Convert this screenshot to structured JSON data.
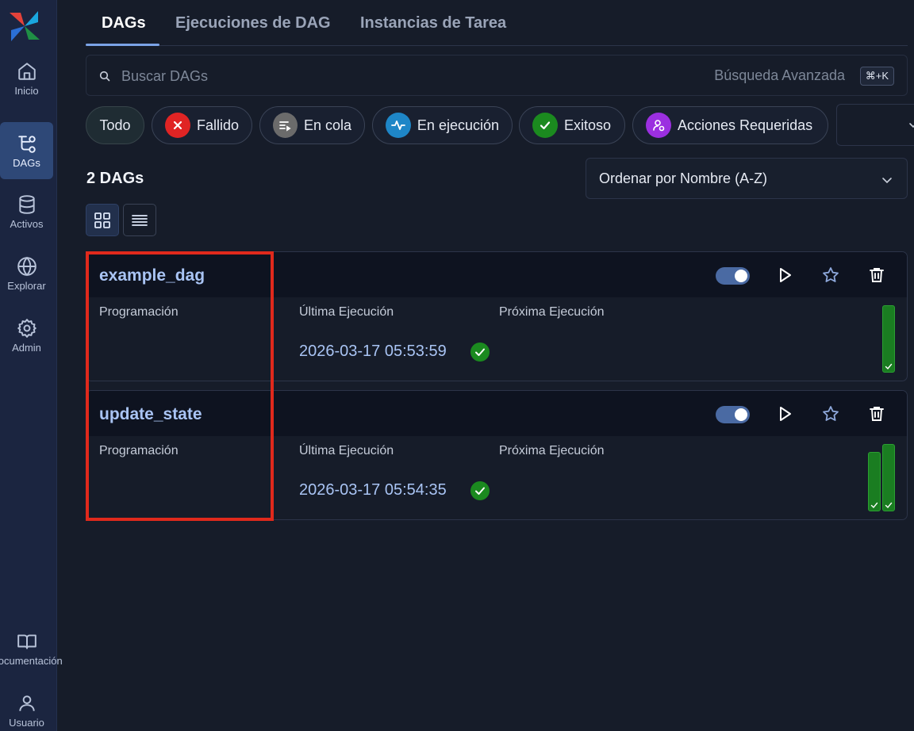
{
  "sidebar": {
    "items": [
      {
        "label": "Inicio",
        "icon": "home-icon"
      },
      {
        "label": "DAGs",
        "icon": "dags-icon",
        "active": true
      },
      {
        "label": "Activos",
        "icon": "database-icon"
      },
      {
        "label": "Explorar",
        "icon": "globe-icon"
      },
      {
        "label": "Admin",
        "icon": "gear-icon"
      }
    ],
    "bottom": [
      {
        "label": "Documentación",
        "icon": "book-icon"
      },
      {
        "label": "Usuario",
        "icon": "user-icon"
      }
    ]
  },
  "tabs": [
    {
      "label": "DAGs",
      "active": true
    },
    {
      "label": "Ejecuciones de DAG"
    },
    {
      "label": "Instancias de Tarea"
    }
  ],
  "search": {
    "placeholder": "Buscar DAGs",
    "advanced_label": "Búsqueda Avanzada",
    "shortcut": "⌘+K"
  },
  "filters": [
    {
      "label": "Todo"
    },
    {
      "label": "Fallido",
      "icon": "x-icon",
      "color": "#e02424"
    },
    {
      "label": "En cola",
      "icon": "queue-icon",
      "color": "#6b6b6b"
    },
    {
      "label": "En ejecución",
      "icon": "activity-icon",
      "color": "#1e86c7"
    },
    {
      "label": "Exitoso",
      "icon": "check-icon",
      "color": "#1b8a1f"
    },
    {
      "label": "Acciones Requeridas",
      "icon": "user-action-icon",
      "color": "#9b2fe0"
    }
  ],
  "dag_count": "2 DAGs",
  "sort": {
    "label": "Ordenar por Nombre (A-Z)"
  },
  "columns": {
    "schedule": "Programación",
    "last_run": "Última Ejecución",
    "next_run": "Próxima Ejecución"
  },
  "dags": [
    {
      "name": "example_dag",
      "last_run": "2026-03-17 05:53:59",
      "status": "success",
      "enabled": true,
      "recent_runs": [
        "success"
      ]
    },
    {
      "name": "update_state",
      "last_run": "2026-03-17 05:54:35",
      "status": "success",
      "enabled": true,
      "recent_runs": [
        "success",
        "success"
      ]
    }
  ],
  "colors": {
    "accent": "#7ba3e6",
    "success": "#1b8a1f",
    "link": "#a9c4f4",
    "highlight": "#e0291c"
  }
}
